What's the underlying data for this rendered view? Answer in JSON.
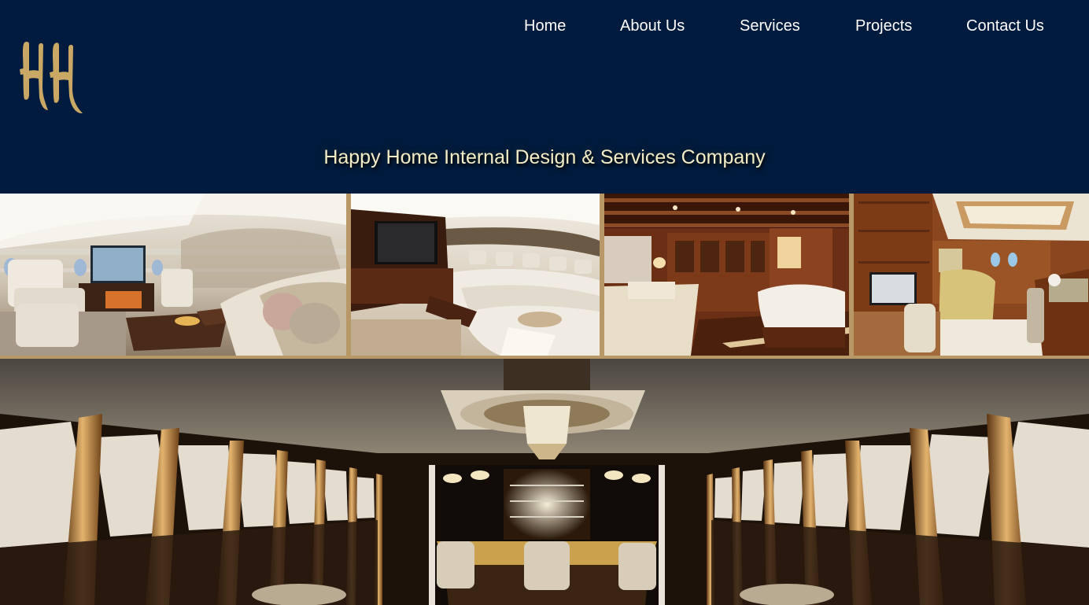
{
  "brand": {
    "logo_text": "HH",
    "tagline": "Happy Home Internal Design & Services Company"
  },
  "nav": {
    "items": [
      {
        "label": "Home"
      },
      {
        "label": "About Us"
      },
      {
        "label": "Services"
      },
      {
        "label": "Projects"
      },
      {
        "label": "Contact Us"
      }
    ]
  },
  "colors": {
    "header_bg": "#001b3d",
    "logo_gold": "#c9a865",
    "nav_text": "#ffffff",
    "tagline_text": "#f3edc7",
    "strip_border": "#b89867"
  },
  "gallery": [
    {
      "subject": "jet-lounge-photo"
    },
    {
      "subject": "jet-sofa-photo"
    },
    {
      "subject": "wood-bedroom-photo"
    },
    {
      "subject": "wood-office-photo"
    }
  ],
  "hero": {
    "subject": "jet-bar-photo"
  }
}
